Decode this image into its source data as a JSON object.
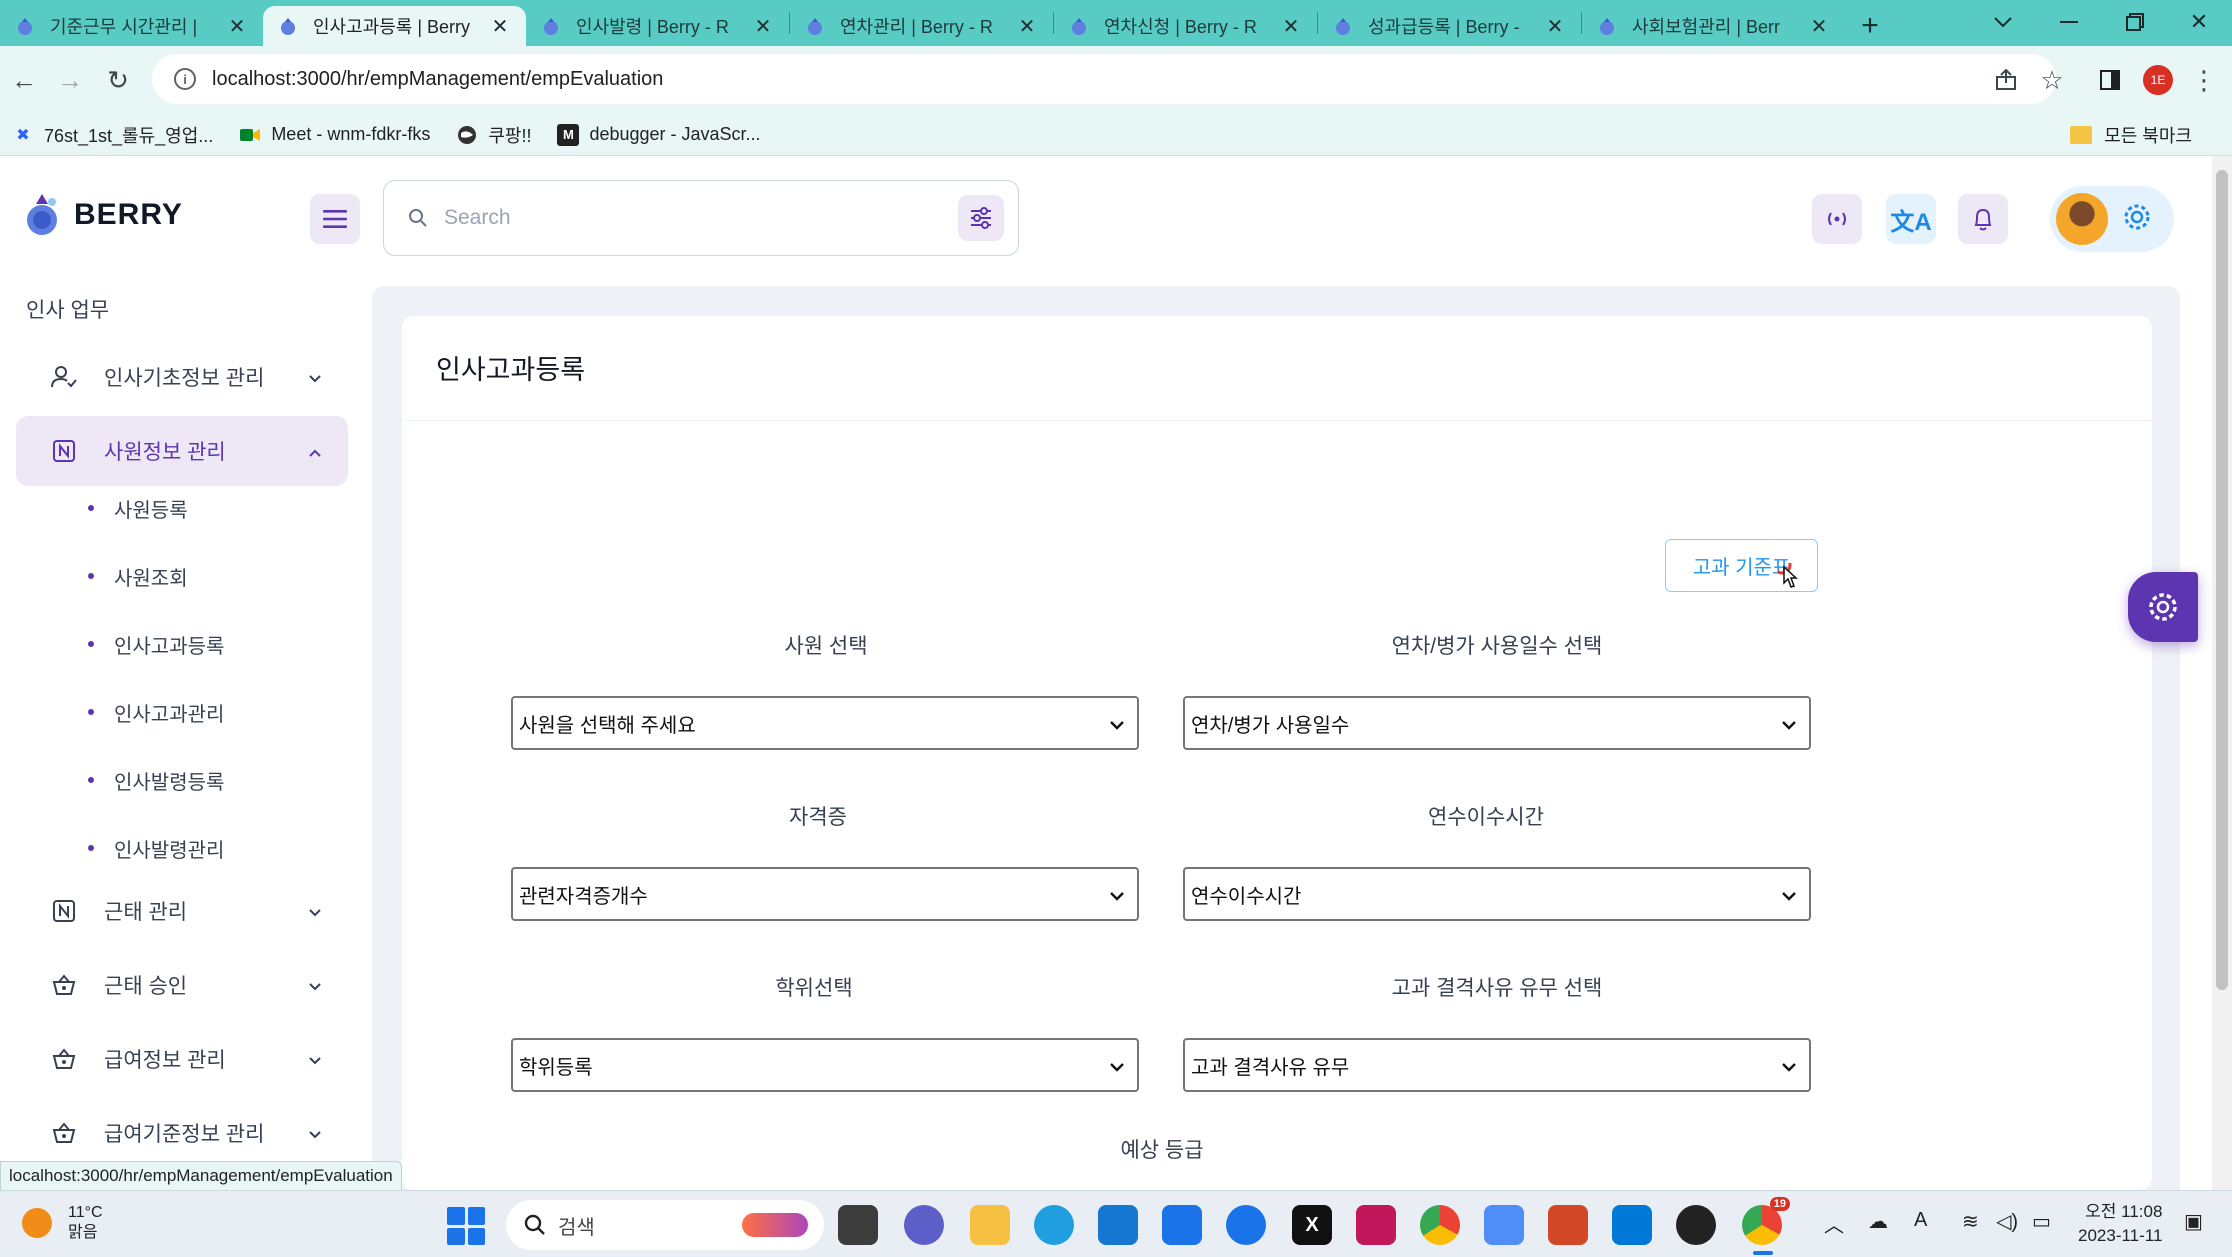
{
  "browser": {
    "tabs": [
      {
        "title": "기준근무 시간관리 | "
      },
      {
        "title": "인사고과등록 | Berry"
      },
      {
        "title": "인사발령 | Berry - R"
      },
      {
        "title": "연차관리 | Berry - R"
      },
      {
        "title": "연차신청 | Berry - R"
      },
      {
        "title": "성과급등록 | Berry - "
      },
      {
        "title": "사회보험관리 | Berr"
      }
    ],
    "new_tab": "+",
    "url": "localhost:3000/hr/empManagement/empEvaluation",
    "profile_badge": "1E",
    "bookmarks": [
      {
        "label": "76st_1st_롤듀_영업..."
      },
      {
        "label": "Meet - wnm-fdkr-fks"
      },
      {
        "label": "쿠팡!!"
      },
      {
        "label": "debugger - JavaScr..."
      }
    ],
    "all_bookmarks": "모든 북마크",
    "status_url": "localhost:3000/hr/empManagement/empEvaluation"
  },
  "app": {
    "brand": "BERRY",
    "search_placeholder": "Search",
    "sidebar": {
      "caption": "인사 업무",
      "groups": [
        {
          "label": "인사기초정보 관리"
        },
        {
          "label": "사원정보 관리"
        },
        {
          "label": "근태 관리"
        },
        {
          "label": "근태 승인"
        },
        {
          "label": "급여정보 관리"
        },
        {
          "label": "급여기준정보 관리"
        }
      ],
      "sub_items": [
        {
          "label": "사원등록"
        },
        {
          "label": "사원조회"
        },
        {
          "label": "인사고과등록"
        },
        {
          "label": "인사고과관리"
        },
        {
          "label": "인사발령등록"
        },
        {
          "label": "인사발령관리"
        }
      ]
    },
    "page_title": "인사고과등록",
    "criteria_button": "고과 기준표",
    "form": {
      "employee": {
        "label": "사원 선택",
        "value": "사원을 선택해 주세요"
      },
      "leave": {
        "label": "연차/병가 사용일수 선택",
        "value": "연차/병가 사용일수"
      },
      "cert": {
        "label": "자격증",
        "value": "관련자격증개수"
      },
      "training": {
        "label": "연수이수시간",
        "value": "연수이수시간"
      },
      "degree": {
        "label": "학위선택",
        "value": "학위등록"
      },
      "disqualify": {
        "label": "고과 결격사유 유무 선택",
        "value": "고과 결격사유 유무"
      },
      "expected_grade_label": "예상 등급"
    }
  },
  "taskbar": {
    "temperature": "11°C",
    "weather": "맑음",
    "search": "검색",
    "time": "오전 11:08",
    "date": "2023-11-11",
    "chrome_badge": "19",
    "colors": {
      "accent": "#5e35b1",
      "chrome": "#57cbc4"
    }
  }
}
